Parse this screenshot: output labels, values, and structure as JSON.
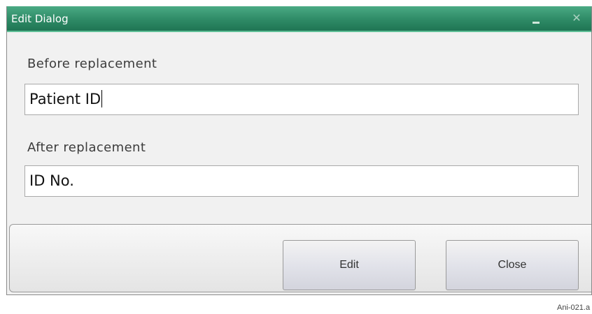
{
  "window": {
    "title": "Edit Dialog",
    "controls": {
      "minimize_icon": "minimize-icon",
      "close_icon": "close-icon",
      "close_glyph": "✕"
    }
  },
  "form": {
    "before_label": "Before replacement",
    "before_value": "Patient ID",
    "after_label": "After replacement",
    "after_value": "ID No."
  },
  "buttons": {
    "edit_label": "Edit",
    "close_label": "Close"
  },
  "caption": "Ani-021.a",
  "colors": {
    "titlebar": "#2e8a66",
    "titlebar_accent": "#5fbf97",
    "dialog_bg": "#f1f1f1"
  }
}
